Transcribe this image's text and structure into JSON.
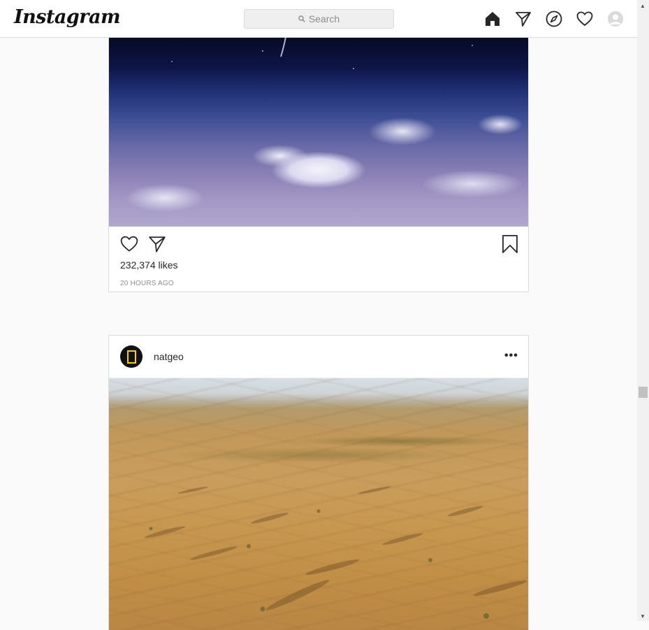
{
  "nav": {
    "logo": "Instagram",
    "search_placeholder": "Search",
    "icons": [
      "home-icon",
      "direct-icon",
      "explore-icon",
      "activity-icon",
      "profile-avatar"
    ]
  },
  "post1": {
    "likes": "232,374 likes",
    "time": "20 HOURS AGO"
  },
  "post2": {
    "username": "natgeo",
    "more": "•••"
  },
  "colors": {
    "background": "#fafafa",
    "border": "#dbdbdb",
    "text": "#262626",
    "muted": "#8e8e8e",
    "natgeo_yellow": "#ffce00"
  }
}
